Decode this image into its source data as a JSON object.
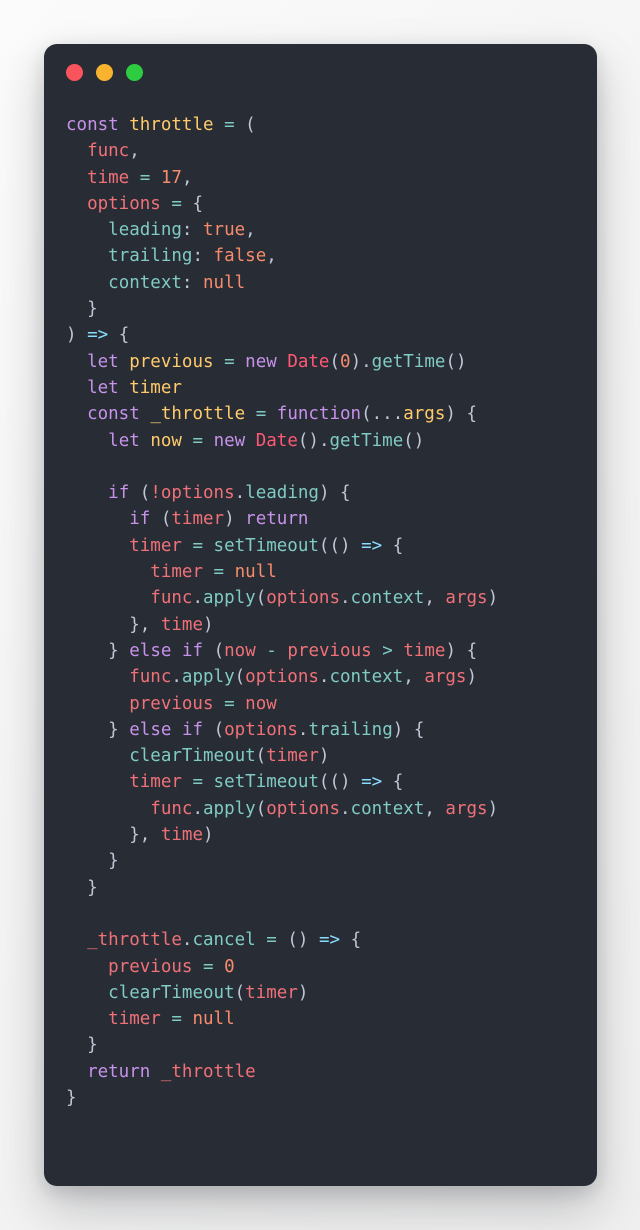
{
  "window": {
    "background_color": "#282c35",
    "page_background": "#f4f4f4",
    "traffic_lights": [
      {
        "name": "close",
        "color": "#f9545b"
      },
      {
        "name": "minimize",
        "color": "#f9b32f"
      },
      {
        "name": "maximize",
        "color": "#2ecc40"
      }
    ]
  },
  "palette": {
    "keyword": "#c792ea",
    "declared_identifier": "#ffcb6b",
    "variable": "#f07178",
    "property": "#80cbc4",
    "literal": "#f78c6c",
    "class": "#ff5874",
    "punctuation": "#bfc7d5",
    "arrow": "#89ddff"
  },
  "code": {
    "language": "javascript",
    "raw": "const throttle = (\n  func,\n  time = 17,\n  options = {\n    leading: true,\n    trailing: false,\n    context: null\n  }\n) => {\n  let previous = new Date(0).getTime()\n  let timer\n  const _throttle = function(...args) {\n    let now = new Date().getTime()\n\n    if (!options.leading) {\n      if (timer) return\n      timer = setTimeout(() => {\n        timer = null\n        func.apply(options.context, args)\n      }, time)\n    } else if (now - previous > time) {\n      func.apply(options.context, args)\n      previous = now\n    } else if (options.trailing) {\n      clearTimeout(timer)\n      timer = setTimeout(() => {\n        func.apply(options.context, args)\n      }, time)\n    }\n  }\n\n  _throttle.cancel = () => {\n    previous = 0\n    clearTimeout(timer)\n    timer = null\n  }\n  return _throttle\n}",
    "lines": [
      "const throttle = (",
      "  func,",
      "  time = 17,",
      "  options = {",
      "    leading: true,",
      "    trailing: false,",
      "    context: null",
      "  }",
      ") => {",
      "  let previous = new Date(0).getTime()",
      "  let timer",
      "  const _throttle = function(...args) {",
      "    let now = new Date().getTime()",
      "",
      "    if (!options.leading) {",
      "      if (timer) return",
      "      timer = setTimeout(() => {",
      "        timer = null",
      "        func.apply(options.context, args)",
      "      }, time)",
      "    } else if (now - previous > time) {",
      "      func.apply(options.context, args)",
      "      previous = now",
      "    } else if (options.trailing) {",
      "      clearTimeout(timer)",
      "      timer = setTimeout(() => {",
      "        func.apply(options.context, args)",
      "      }, time)",
      "    }",
      "  }",
      "",
      "  _throttle.cancel = () => {",
      "    previous = 0",
      "    clearTimeout(timer)",
      "    timer = null",
      "  }",
      "  return _throttle",
      "}"
    ]
  }
}
